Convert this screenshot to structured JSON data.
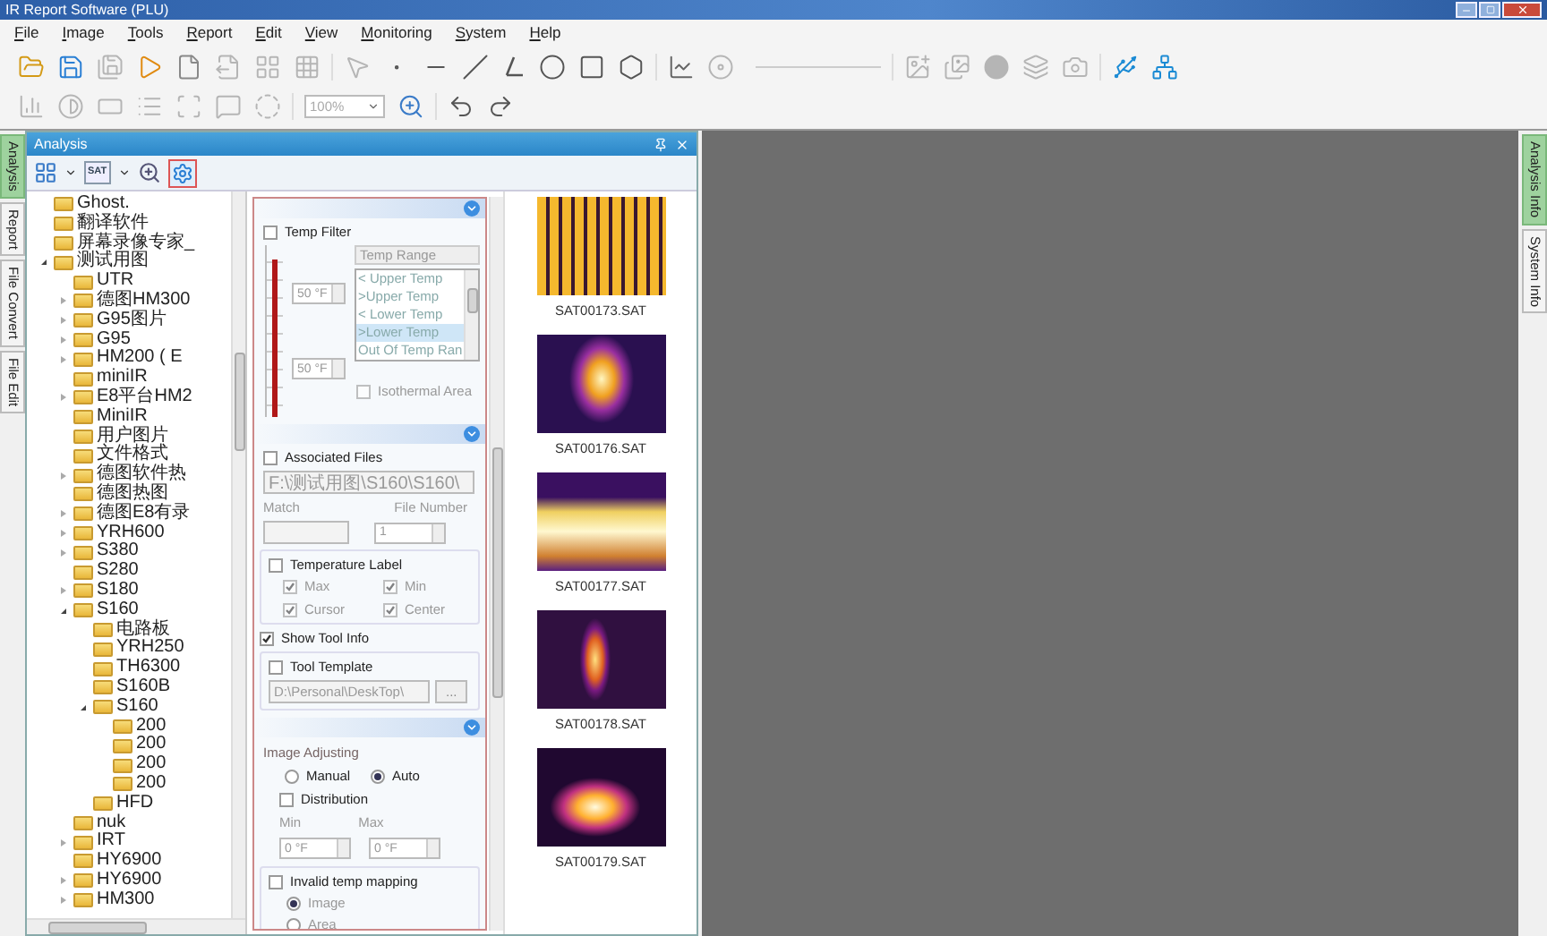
{
  "window": {
    "title": "IR Report Software (PLU)"
  },
  "menu": [
    "File",
    "Image",
    "Tools",
    "Report",
    "Edit",
    "View",
    "Monitoring",
    "System",
    "Help"
  ],
  "toolbar_rows": [
    [
      [
        {
          "kind": "open-folder",
          "disabled": false
        },
        {
          "kind": "save",
          "disabled": false
        },
        {
          "kind": "save-all",
          "disabled": true
        },
        {
          "kind": "play",
          "disabled": false
        },
        {
          "kind": "document",
          "disabled": false
        },
        {
          "kind": "export",
          "disabled": true
        },
        {
          "kind": "grid",
          "disabled": true
        },
        {
          "kind": "grid-fine",
          "disabled": true
        }
      ],
      [
        {
          "kind": "pointer",
          "disabled": true
        },
        {
          "kind": "point",
          "disabled": false
        },
        {
          "kind": "line",
          "disabled": false
        },
        {
          "kind": "slash",
          "disabled": false
        },
        {
          "kind": "angle",
          "disabled": false
        },
        {
          "kind": "circle",
          "disabled": false
        },
        {
          "kind": "square",
          "disabled": false
        },
        {
          "kind": "hexagon",
          "disabled": false
        }
      ],
      [
        {
          "kind": "chart",
          "disabled": false
        },
        {
          "kind": "disc",
          "disabled": true
        }
      ],
      [
        {
          "kind": "image-add",
          "disabled": true
        },
        {
          "kind": "images",
          "disabled": true
        },
        {
          "kind": "blob",
          "disabled": true
        },
        {
          "kind": "layers",
          "disabled": true
        },
        {
          "kind": "camera",
          "disabled": true
        }
      ],
      [
        {
          "kind": "usb",
          "disabled": false
        },
        {
          "kind": "network",
          "disabled": false
        }
      ]
    ],
    [
      [
        {
          "kind": "bar-chart",
          "disabled": true
        },
        {
          "kind": "contrast",
          "disabled": true
        },
        {
          "kind": "rectangle",
          "disabled": true
        },
        {
          "kind": "list",
          "disabled": true
        },
        {
          "kind": "scan",
          "disabled": true
        },
        {
          "kind": "message",
          "disabled": true
        },
        {
          "kind": "dashed-circle",
          "disabled": true
        }
      ],
      [
        {
          "kind": "zoom-select",
          "value": "100%",
          "disabled": true
        },
        {
          "kind": "zoom",
          "disabled": false
        }
      ],
      [
        {
          "kind": "undo",
          "disabled": false
        },
        {
          "kind": "redo",
          "disabled": false
        }
      ]
    ]
  ],
  "left_tabs": [
    {
      "label": "Analysis",
      "selected": true
    },
    {
      "label": "Report",
      "selected": false
    },
    {
      "label": "File Convert",
      "selected": false
    },
    {
      "label": "File Edit",
      "selected": false
    }
  ],
  "right_tabs": [
    {
      "label": "Analysis Info",
      "selected": true
    },
    {
      "label": "System Info",
      "selected": false
    }
  ],
  "panel": {
    "title": "Analysis",
    "sat_label": "SAT"
  },
  "tree": [
    {
      "label": "Ghost."
    },
    {
      "label": "翻译软件"
    },
    {
      "label": "屏幕录像专家_"
    },
    {
      "label": "测试用图",
      "expanded": true,
      "children": [
        {
          "label": "UTR"
        },
        {
          "label": "德图HM300",
          "expanded": false
        },
        {
          "label": "G95图片",
          "expanded": false
        },
        {
          "label": "G95",
          "expanded": false
        },
        {
          "label": "HM200 ( E",
          "expanded": false
        },
        {
          "label": "miniIR"
        },
        {
          "label": "E8平台HM2",
          "expanded": false
        },
        {
          "label": "MiniIR"
        },
        {
          "label": "用户图片"
        },
        {
          "label": "文件格式"
        },
        {
          "label": "德图软件热",
          "expanded": false
        },
        {
          "label": "德图热图"
        },
        {
          "label": "德图E8有录",
          "expanded": false
        },
        {
          "label": "YRH600",
          "expanded": false
        },
        {
          "label": "S380",
          "expanded": false
        },
        {
          "label": "S280"
        },
        {
          "label": "S180",
          "expanded": false
        },
        {
          "label": "S160",
          "expanded": true,
          "children": [
            {
              "label": "电路板"
            },
            {
              "label": "YRH250"
            },
            {
              "label": "TH6300"
            },
            {
              "label": "S160B"
            },
            {
              "label": "S160",
              "expanded": true,
              "children": [
                {
                  "label": "200"
                },
                {
                  "label": "200"
                },
                {
                  "label": "200"
                },
                {
                  "label": "200"
                }
              ]
            },
            {
              "label": "HFD"
            }
          ]
        },
        {
          "label": "nuk"
        },
        {
          "label": "IRT",
          "expanded": false
        },
        {
          "label": "HY6900"
        },
        {
          "label": "HY6900",
          "expanded": false
        },
        {
          "label": "HM300",
          "expanded": false
        }
      ]
    }
  ],
  "filter": {
    "temp_filter": {
      "label": "Temp Filter",
      "checked": false,
      "level": 0.92,
      "upper": "50 °F",
      "lower": "50 °F",
      "range_header": "Temp Range",
      "range_options": [
        {
          "label": "< Upper Temp",
          "selected": false
        },
        {
          "label": ">Upper Temp",
          "selected": false
        },
        {
          "label": "< Lower Temp",
          "selected": false
        },
        {
          "label": ">Lower Temp",
          "selected": true
        },
        {
          "label": "Out Of Temp Ran",
          "selected": false
        }
      ],
      "isothermal": {
        "label": "Isothermal Area",
        "checked": false
      }
    },
    "associated_files": {
      "label": "Associated Files",
      "checked": false,
      "path": "F:\\测试用图\\S160\\S160\\",
      "match_label": "Match",
      "file_number_label": "File Number",
      "file_number": "1"
    },
    "temperature_label": {
      "label": "Temperature Label",
      "checked": false,
      "options": [
        {
          "label": "Max",
          "checked": true
        },
        {
          "label": "Min",
          "checked": true
        },
        {
          "label": "Cursor",
          "checked": true
        },
        {
          "label": "Center",
          "checked": true
        }
      ]
    },
    "show_tool_info": {
      "label": "Show Tool Info",
      "checked": true
    },
    "tool_template": {
      "label": "Tool Template",
      "checked": false,
      "path": "D:\\Personal\\DeskTop\\",
      "browse": "..."
    },
    "image_adjusting": {
      "title": "Image Adjusting",
      "modes": [
        {
          "label": "Manual",
          "selected": false
        },
        {
          "label": "Auto",
          "selected": true
        }
      ],
      "distribution": {
        "label": "Distribution",
        "checked": false
      },
      "min_label": "Min",
      "max_label": "Max",
      "min": "0 °F",
      "max": "0 °F",
      "invalid_mapping": {
        "label": "Invalid temp mapping",
        "checked": false
      },
      "mapping_targets": [
        {
          "label": "Image",
          "selected": true
        },
        {
          "label": "Area",
          "selected": false
        }
      ]
    }
  },
  "thumbnails": [
    {
      "file": "SAT00173.SAT"
    },
    {
      "file": "SAT00176.SAT"
    },
    {
      "file": "SAT00177.SAT"
    },
    {
      "file": "SAT00178.SAT"
    },
    {
      "file": "SAT00179.SAT"
    }
  ]
}
